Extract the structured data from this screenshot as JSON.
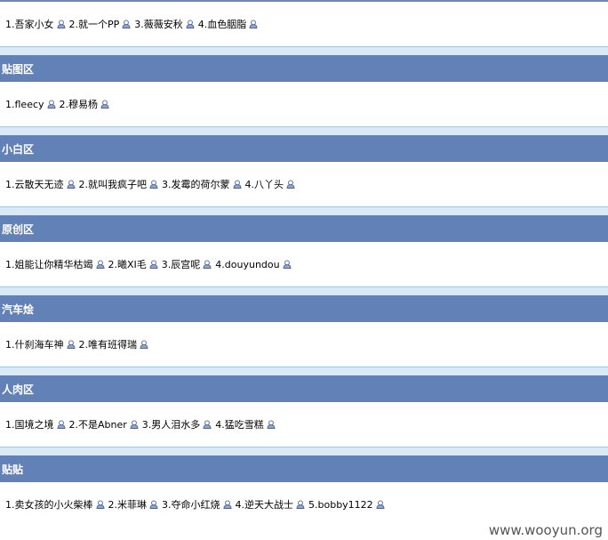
{
  "sections": [
    {
      "title": "",
      "entries": [
        "1.吾家小女",
        "2.就一个PP",
        "3.薇薇安秋",
        "4.血色胭脂"
      ]
    },
    {
      "title": "贴图区",
      "entries": [
        "1.fleecy",
        "2.穆易杨"
      ]
    },
    {
      "title": "小白区",
      "entries": [
        "1.云散天无迹",
        "2.就叫我疯子吧",
        "3.发霉的荷尔蒙",
        "4.八丫头"
      ]
    },
    {
      "title": "原创区",
      "entries": [
        "1.姐能让你精华枯竭",
        "2.曦XI毛",
        "3.辰宫呢",
        "4.douyundou"
      ]
    },
    {
      "title": "汽车烩",
      "entries": [
        "1.什刹海车神",
        "2.唯有班得瑞"
      ]
    },
    {
      "title": "人肉区",
      "entries": [
        "1.国境之境",
        "2.不是Abner",
        "3.男人泪水多",
        "4.猛吃雪糕"
      ]
    },
    {
      "title": "贴贴",
      "entries": [
        "1.卖女孩的小火柴棒",
        "2.米菲琳",
        "3.夺命小红烧",
        "4.逆天大战士",
        "5.bobby1122"
      ]
    }
  ],
  "watermark": "www.wooyun.org",
  "colors": {
    "header_bg": "#6281b7",
    "gap_bg": "#dbe9f7",
    "icon_color": "#5b74a8"
  },
  "icon": "user-icon"
}
